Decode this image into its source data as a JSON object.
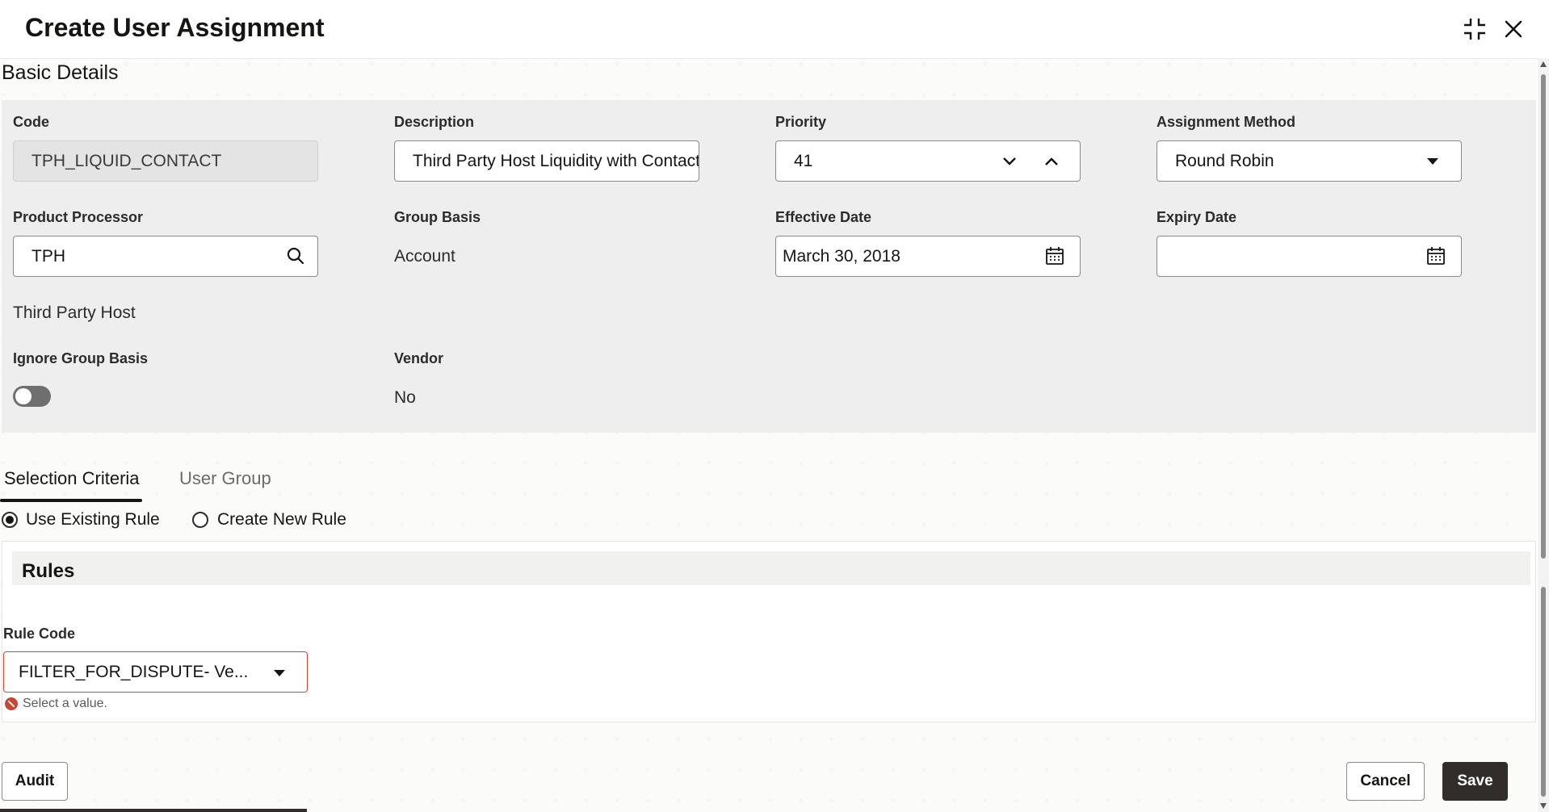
{
  "dialog": {
    "title": "Create User Assignment",
    "section_title": "Basic Details",
    "icons": {
      "collapse": "compress-icon",
      "close": "close-icon"
    }
  },
  "basic": {
    "code": {
      "label": "Code",
      "value": "TPH_LIQUID_CONTACT"
    },
    "description": {
      "label": "Description",
      "value": "Third Party Host Liquidity with Contact"
    },
    "priority": {
      "label": "Priority",
      "value": "41"
    },
    "assignment_method": {
      "label": "Assignment Method",
      "value": "Round Robin"
    },
    "product_processor": {
      "label": "Product Processor",
      "value": "TPH",
      "subtext": "Third Party Host"
    },
    "group_basis": {
      "label": "Group Basis",
      "value": "Account"
    },
    "effective_date": {
      "label": "Effective Date",
      "value": "March 30, 2018"
    },
    "expiry_date": {
      "label": "Expiry Date",
      "value": ""
    },
    "ignore_group_basis": {
      "label": "Ignore Group Basis",
      "on": false
    },
    "vendor": {
      "label": "Vendor",
      "value": "No"
    }
  },
  "tabs": [
    {
      "label": "Selection Criteria",
      "active": true
    },
    {
      "label": "User Group",
      "active": false
    }
  ],
  "rule_options": [
    {
      "label": "Use Existing Rule",
      "checked": true
    },
    {
      "label": "Create New Rule",
      "checked": false
    }
  ],
  "rules": {
    "title": "Rules",
    "rule_code_label": "Rule Code",
    "rule_code_value": "FILTER_FOR_DISPUTE- Ve...",
    "error": "Select a value."
  },
  "footer": {
    "audit": "Audit",
    "cancel": "Cancel",
    "save": "Save"
  },
  "colors": {
    "primary_button": "#312d2a",
    "error": "#c74634",
    "panel": "#eeeeee"
  }
}
